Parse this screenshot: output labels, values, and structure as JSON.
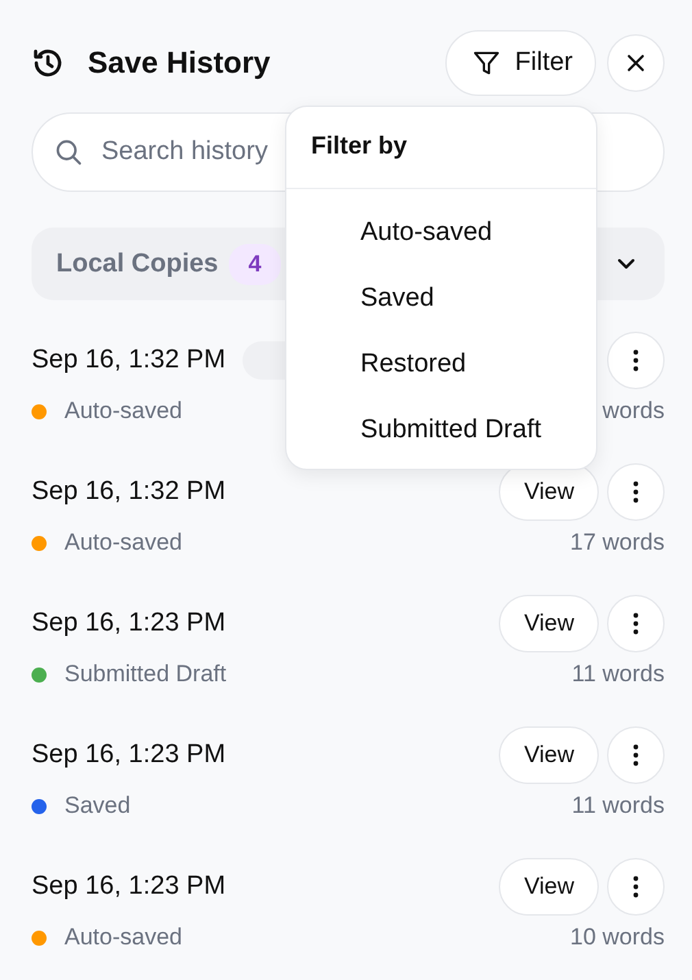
{
  "header": {
    "title": "Save History",
    "filter_button": "Filter"
  },
  "search": {
    "placeholder": "Search history"
  },
  "section": {
    "label": "Local Copies",
    "count": "4"
  },
  "filter_menu": {
    "title": "Filter by",
    "options": [
      "Auto-saved",
      "Saved",
      "Restored",
      "Submitted Draft"
    ]
  },
  "entries": [
    {
      "date": "Sep 16, 1:32 PM",
      "status": "Auto-saved",
      "color": "#ff9800",
      "words": "words"
    },
    {
      "date": "Sep 16, 1:32 PM",
      "status": "Auto-saved",
      "color": "#ff9800",
      "words": "17 words",
      "view": "View"
    },
    {
      "date": "Sep 16, 1:23 PM",
      "status": "Submitted Draft",
      "color": "#4caf50",
      "words": "11 words",
      "view": "View"
    },
    {
      "date": "Sep 16, 1:23 PM",
      "status": "Saved",
      "color": "#2563eb",
      "words": "11 words",
      "view": "View"
    },
    {
      "date": "Sep 16, 1:23 PM",
      "status": "Auto-saved",
      "color": "#ff9800",
      "words": "10 words",
      "view": "View"
    }
  ]
}
